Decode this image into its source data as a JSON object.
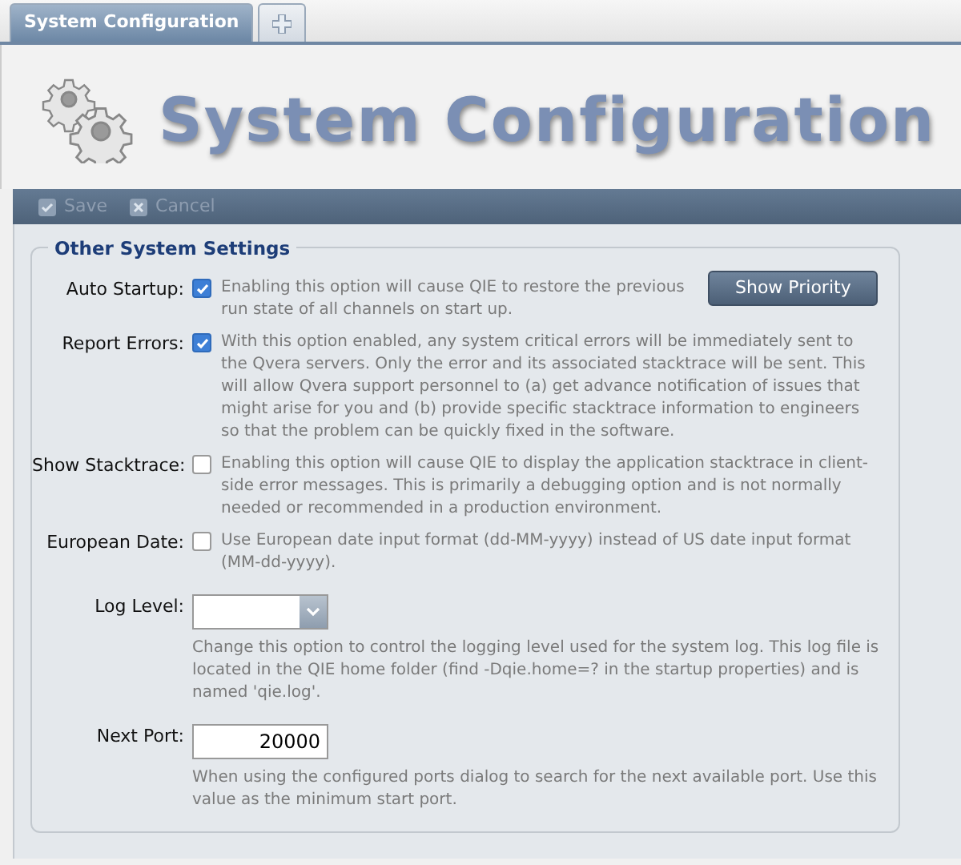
{
  "tabs": [
    {
      "kind": "text",
      "label": "System Configuration",
      "selected": true
    },
    {
      "kind": "add",
      "selected": false
    }
  ],
  "header": {
    "title": "System Configuration"
  },
  "toolbar": {
    "buttons": [
      {
        "kind": "save",
        "label": "Save",
        "disabled": true
      },
      {
        "kind": "cancel",
        "label": "Cancel",
        "disabled": true
      }
    ]
  },
  "section": {
    "title": "Other System Settings",
    "action_button": "Show Priority",
    "settings": [
      {
        "kind": "checkbox",
        "label": "Auto Startup:",
        "checked": true,
        "description": "Enabling this option will cause QIE to restore the previous run state of all channels on start up."
      },
      {
        "kind": "checkbox",
        "label": "Report Errors:",
        "checked": true,
        "description": "With this option enabled, any system critical errors will be immediately sent to the Qvera servers. Only the error and its associated stacktrace will be sent. This will allow Qvera support personnel to (a) get advance notification of issues that might arise for you and (b) provide specific stacktrace information to engineers so that the problem can be quickly fixed in the software."
      },
      {
        "kind": "checkbox",
        "label": "Show Stacktrace:",
        "checked": false,
        "description": "Enabling this option will cause QIE to display the application stacktrace in client-side error messages. This is primarily a debugging option and is not normally needed or recommended in a production environment."
      },
      {
        "kind": "checkbox",
        "label": "European Date:",
        "checked": false,
        "description": "Use European date input format (dd-MM-yyyy) instead of US date input format (MM-dd-yyyy)."
      },
      {
        "kind": "select",
        "label": "Log Level:",
        "description": "Change this option to control the logging level used for the system log. This log file is located in the QIE home folder (find -Dqie.home=? in the startup properties) and is named 'qie.log'."
      },
      {
        "kind": "number",
        "label": "Next Port:",
        "value": "20000",
        "description": "When using the configured ports dialog to search for the next available port. Use this value as the minimum start port."
      }
    ]
  }
}
